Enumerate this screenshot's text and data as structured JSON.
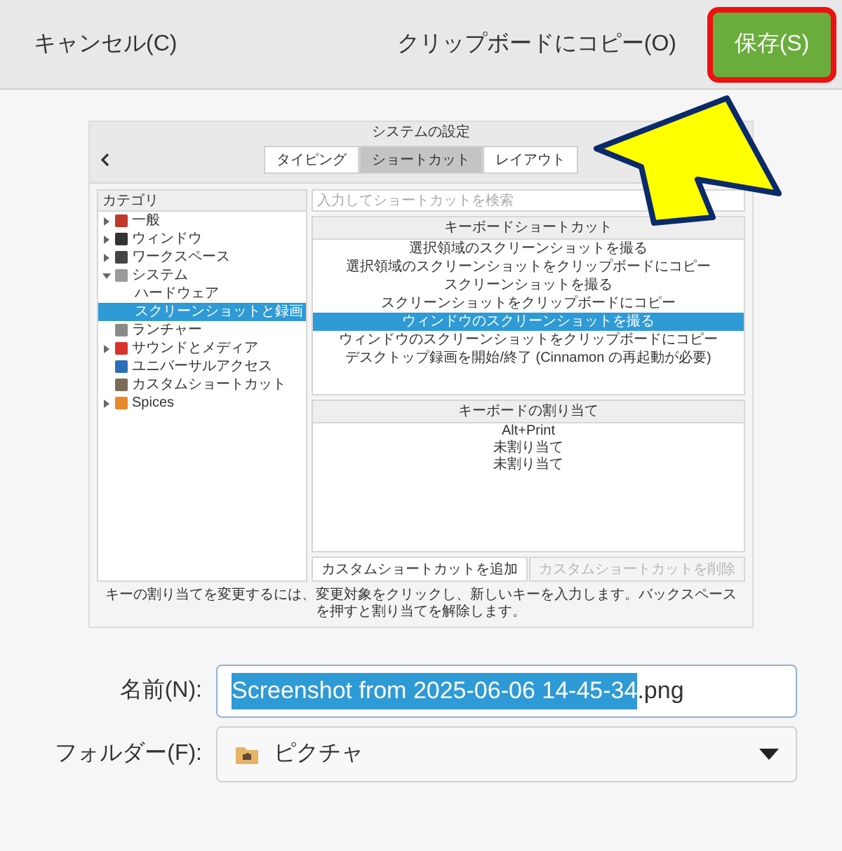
{
  "header": {
    "cancel": "キャンセル(C)",
    "copy": "クリップボードにコピー(O)",
    "save": "保存(S)",
    "save_highlighted": true
  },
  "preview": {
    "title": "システムの設定",
    "tabs": [
      {
        "label": "タイピング",
        "selected": false
      },
      {
        "label": "ショートカット",
        "selected": true
      },
      {
        "label": "レイアウト",
        "selected": false
      }
    ],
    "sidebar": {
      "heading": "カテゴリ",
      "items": [
        {
          "label": "一般",
          "color": "#c0392b",
          "kind": "group",
          "expanded": false,
          "selected": false
        },
        {
          "label": "ウィンドウ",
          "color": "#333333",
          "kind": "group",
          "expanded": false,
          "selected": false
        },
        {
          "label": "ワークスペース",
          "color": "#444444",
          "kind": "group",
          "expanded": false,
          "selected": false
        },
        {
          "label": "システム",
          "color": "#9a9a9a",
          "kind": "group",
          "expanded": true,
          "selected": false,
          "children": [
            {
              "label": "ハードウェア",
              "selected": false
            },
            {
              "label": "スクリーンショットと録画",
              "selected": true
            }
          ]
        },
        {
          "label": "ランチャー",
          "color": "#8a8a8a",
          "kind": "leaf",
          "selected": false
        },
        {
          "label": "サウンドとメディア",
          "color": "#d9342b",
          "kind": "group",
          "expanded": false,
          "selected": false
        },
        {
          "label": "ユニバーサルアクセス",
          "color": "#2a6fb8",
          "kind": "leaf",
          "selected": false
        },
        {
          "label": "カスタムショートカット",
          "color": "#7a6a5a",
          "kind": "leaf",
          "selected": false
        },
        {
          "label": "Spices",
          "color": "#e8892b",
          "kind": "group",
          "expanded": false,
          "selected": false
        }
      ]
    },
    "search": {
      "placeholder": "入力してショートカットを検索"
    },
    "shortcuts": {
      "heading": "キーボードショートカット",
      "rows": [
        {
          "label": "選択領域のスクリーンショットを撮る",
          "selected": false
        },
        {
          "label": "選択領域のスクリーンショットをクリップボードにコピー",
          "selected": false
        },
        {
          "label": "スクリーンショットを撮る",
          "selected": false
        },
        {
          "label": "スクリーンショットをクリップボードにコピー",
          "selected": false
        },
        {
          "label": "ウィンドウのスクリーンショットを撮る",
          "selected": true
        },
        {
          "label": "ウィンドウのスクリーンショットをクリップボードにコピー",
          "selected": false
        },
        {
          "label": "デスクトップ録画を開始/終了 (Cinnamon の再起動が必要)",
          "selected": false
        }
      ]
    },
    "bindings": {
      "heading": "キーボードの割り当て",
      "rows": [
        "Alt+Print",
        "未割り当て",
        "未割り当て"
      ]
    },
    "buttons": [
      {
        "label": "カスタムショートカットを追加",
        "disabled": false
      },
      {
        "label": "カスタムショートカットを削除",
        "disabled": true
      }
    ],
    "hint": "キーの割り当てを変更するには、変更対象をクリックし、新しいキーを入力します。バックスペースを押すと割り当てを解除します。"
  },
  "name_field": {
    "label": "名前(N):",
    "selected_text": "Screenshot from 2025-06-06 14-45-34",
    "text": ".png"
  },
  "folder_field": {
    "label": "フォルダー(F):",
    "value": "ピクチャ"
  }
}
